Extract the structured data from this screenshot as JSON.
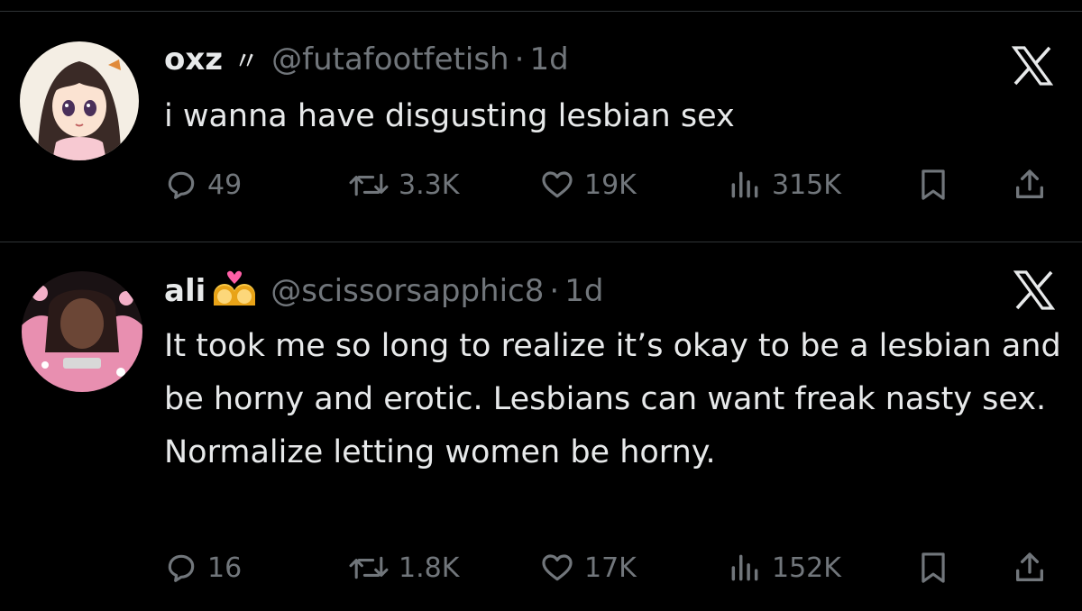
{
  "tweets": [
    {
      "name": "oxz",
      "name_suffix": "〃",
      "handle": "@futafootfetish",
      "separator": "·",
      "time": "1d",
      "text": "i wanna have disgusting lesbian sex",
      "replies": "49",
      "reposts": "3.3K",
      "likes": "19K",
      "views": "315K"
    },
    {
      "name": "ali",
      "name_emoji": "couple-with-heart-woman-woman",
      "handle": "@scissorsapphic8",
      "separator": "·",
      "time": "1d",
      "text": "It took me so long to realize it’s okay to be a lesbian and be horny and erotic. Lesbians can want freak nasty sex. Normalize letting women be horny.",
      "replies": "16",
      "reposts": "1.8K",
      "likes": "17K",
      "views": "152K"
    }
  ],
  "icons": {
    "reply": "reply-icon",
    "repost": "repost-icon",
    "like": "heart-icon",
    "views": "views-icon",
    "bookmark": "bookmark-icon",
    "share": "share-icon",
    "platform": "x-logo-icon"
  },
  "colors": {
    "background": "#000000",
    "text": "#e7e9ea",
    "muted": "#71767b",
    "divider": "#2f3336"
  }
}
